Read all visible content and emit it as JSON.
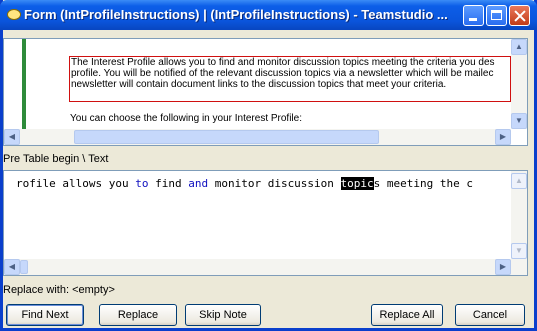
{
  "window": {
    "title": "Form (IntProfileInstructions) | (IntProfileInstructions) - Teamstudio ..."
  },
  "preview": {
    "box_lines": [
      "The Interest Profile allows you to find and monitor discussion topics meeting the criteria you des",
      "profile. You will be notified of the relevant discussion topics via a newsletter which will be mailec",
      "newsletter will contain document links to the discussion topics that meet your criteria."
    ],
    "following_line": "You can choose the following in your Interest Profile:"
  },
  "location": "Pre Table begin \\ Text",
  "editor": {
    "seg1": "rofile allows you ",
    "kw1": "to",
    "seg2": " find ",
    "kw2": "and",
    "seg3": " monitor discussion ",
    "highlight": "topic",
    "seg4": "s meeting the c"
  },
  "replace_label": "Replace with: <empty>",
  "buttons": {
    "find_next": "Find Next",
    "replace": "Replace",
    "skip_note": "Skip Note",
    "replace_all": "Replace All",
    "cancel": "Cancel"
  },
  "icons": {
    "scroll_up": "▲",
    "scroll_down": "▼",
    "scroll_left": "◀",
    "scroll_right": "▶",
    "grip": "⁞⁞⁞"
  }
}
